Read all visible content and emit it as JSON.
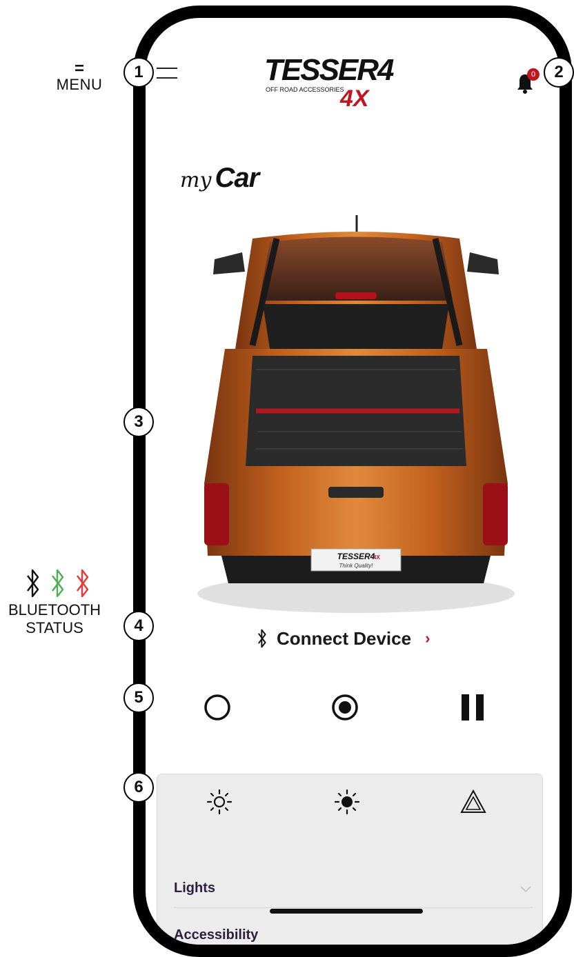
{
  "legend": {
    "menu_symbol": "=",
    "menu_label": "MENU",
    "bluetooth_label_line1": "BLUETOOTH",
    "bluetooth_label_line2": "STATUS",
    "bluetooth_states": [
      "disconnected",
      "connected",
      "error"
    ],
    "bluetooth_colors": [
      "#111111",
      "#4caf50",
      "#e53935"
    ]
  },
  "callouts": [
    "1",
    "2",
    "3",
    "4",
    "5",
    "6"
  ],
  "header": {
    "brand_name": "TESSER4",
    "brand_suffix": "4X",
    "brand_tagline": "OFF ROAD ACCESSORIES",
    "notification_count": "0"
  },
  "page": {
    "title_script": "my",
    "title_bold": "Car"
  },
  "truck_plate": {
    "brand": "TESSER4",
    "suffix": "4X",
    "slogan": "Think Quality!"
  },
  "connect": {
    "label": "Connect Device",
    "chevron": "›"
  },
  "mode_controls": [
    {
      "name": "off",
      "icon": "ring-icon"
    },
    {
      "name": "on",
      "icon": "radio-on-icon"
    },
    {
      "name": "pause",
      "icon": "pause-icon"
    }
  ],
  "panel": {
    "icons": [
      "sun-outline-icon",
      "sun-filled-icon",
      "hazard-triangle-icon"
    ],
    "sections": [
      {
        "label": "Lights"
      },
      {
        "label": "Accessibility"
      }
    ]
  },
  "colors": {
    "accent": "#c0161f",
    "panel_bg": "#ececec",
    "truck_body": "#c2611e"
  }
}
